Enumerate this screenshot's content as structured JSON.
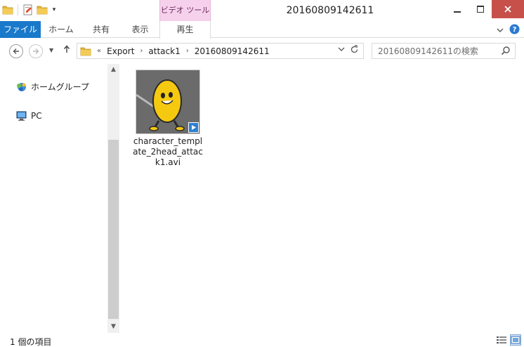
{
  "window": {
    "title": "20160809142611",
    "contextual_tab_group": "ビデオ ツール"
  },
  "ribbon": {
    "tabs": [
      {
        "label": "ファイル"
      },
      {
        "label": "ホーム"
      },
      {
        "label": "共有"
      },
      {
        "label": "表示"
      },
      {
        "label": "再生"
      }
    ]
  },
  "address": {
    "overflow": "«",
    "crumbs": [
      "Export",
      "attack1",
      "20160809142611"
    ],
    "search_placeholder": "20160809142611の検索"
  },
  "nav": {
    "items": [
      {
        "label": "ホームグループ",
        "icon": "homegroup-icon"
      },
      {
        "label": "PC",
        "icon": "computer-icon"
      }
    ]
  },
  "content": {
    "files": [
      {
        "name": "character_template_2head_attack1.avi",
        "type": "video"
      }
    ]
  },
  "status": {
    "item_count": "1 個の項目"
  },
  "colors": {
    "file_tab": "#1979ca",
    "contextual_tab": "#f6d1ec",
    "close_button": "#c7504b"
  }
}
